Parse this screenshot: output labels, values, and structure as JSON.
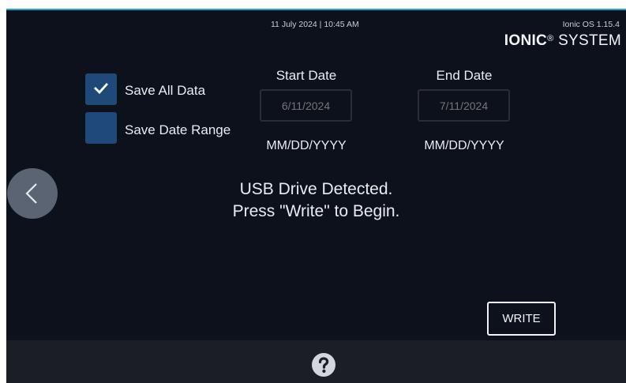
{
  "header": {
    "timestamp": "11 July 2024 | 10:45 AM",
    "os_version": "Ionic OS 1.15.4",
    "brand_bold": "IONIC",
    "brand_mark": "®",
    "brand_rest": "SYSTEM"
  },
  "options": {
    "save_all": {
      "label": "Save All Data",
      "checked": true
    },
    "save_range": {
      "label": "Save Date Range",
      "checked": false
    }
  },
  "start_date": {
    "title": "Start Date",
    "placeholder": "6/11/2024",
    "format": "MM/DD/YYYY"
  },
  "end_date": {
    "title": "End Date",
    "placeholder": "7/11/2024",
    "format": "MM/DD/YYYY"
  },
  "status": {
    "line1": "USB Drive Detected.",
    "line2": "Press \"Write\" to Begin."
  },
  "write_button": {
    "label": "WRITE"
  },
  "colors": {
    "background": "#0c111b",
    "checkbox": "#1f4978",
    "back_button": "#5b6473",
    "bottom_bar": "#1b1f25",
    "accent_line": "#20a3c8"
  },
  "icons": {
    "back": "chevron-left-icon",
    "help": "question-circle-icon",
    "check": "check-icon"
  }
}
